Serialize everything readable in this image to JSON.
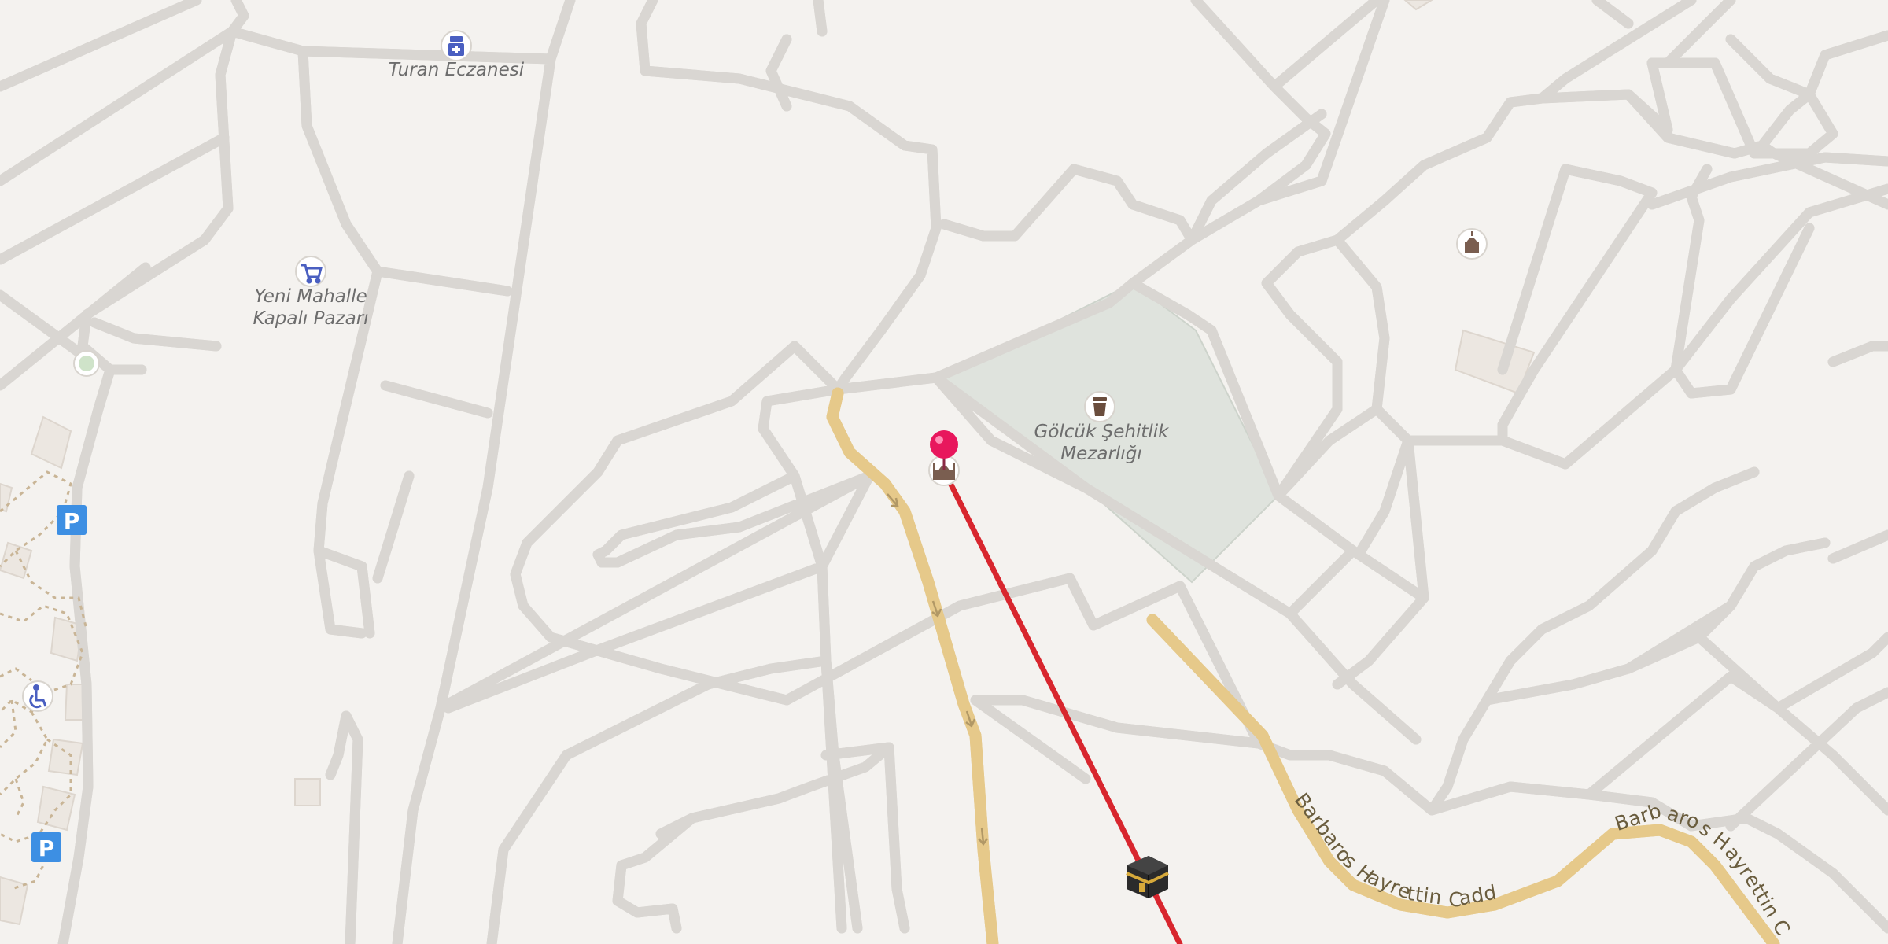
{
  "map": {
    "colors": {
      "background": "#f4f2ef",
      "road": "#ffffff",
      "road_casing": "#d9d6d2",
      "major_road": "#fde19c",
      "cemetery": "#dfe3dd",
      "route_line": "#d8262e",
      "marker": "#e8175d",
      "poi_icon": "#7a5e50",
      "shop_icon": "#4a5fc1",
      "parking": "#3d8fe3"
    },
    "pois": {
      "pharmacy": {
        "label": "Turan Eczanesi",
        "icon": "pharmacy-icon"
      },
      "marketplace": {
        "label_line1": "Yeni Mahalle",
        "label_line2": "Kapalı Pazarı",
        "icon": "shopping-cart-icon"
      },
      "cemetery": {
        "label_line1": "Gölcük Şehitlik",
        "label_line2": "Mezarlığı",
        "icon": "grave-icon"
      },
      "mosque": {
        "icon": "mosque-icon"
      },
      "place_of_worship": {
        "icon": "place-of-worship-icon"
      },
      "accessibility": {
        "icon": "wheelchair-icon"
      },
      "viewpoint": {
        "icon": "park-dot-icon"
      }
    },
    "parking_labels": [
      "P",
      "P"
    ],
    "streets": {
      "barbaros_1": "Barbaros Hayrettin Caddesi",
      "barbaros_2": "Barbaros Hayrettin Cad"
    },
    "route": {
      "start_marker": "location-pin-icon",
      "destination_icon": "kaaba-icon",
      "type": "qibla-direction"
    }
  }
}
